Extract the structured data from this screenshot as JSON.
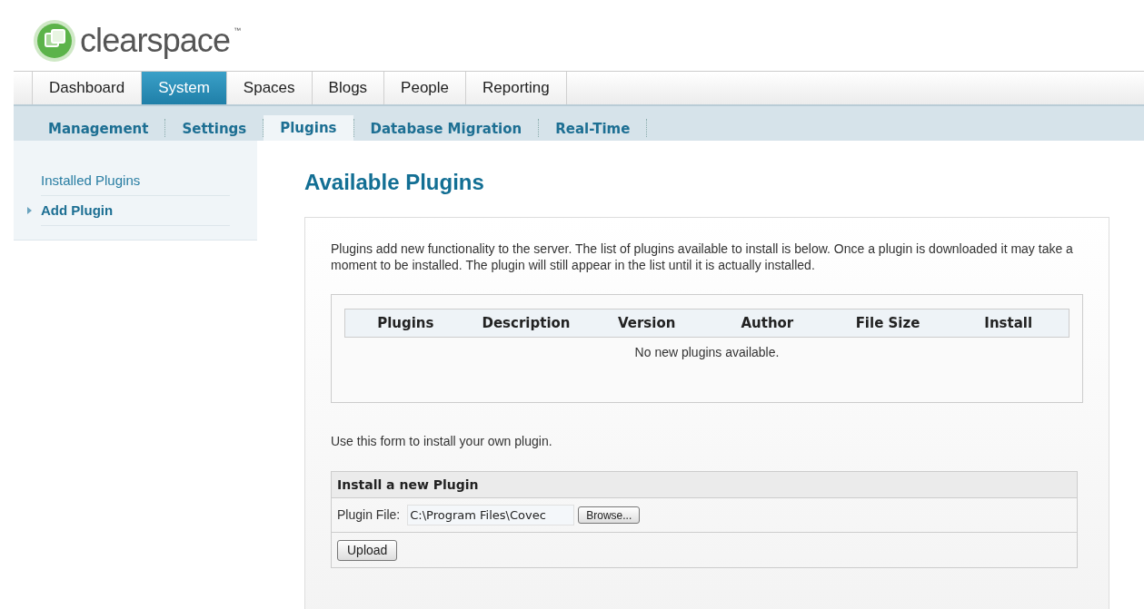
{
  "logo": {
    "name": "clearspace",
    "mark": "™"
  },
  "main_tabs": [
    {
      "label": "Dashboard",
      "selected": false
    },
    {
      "label": "System",
      "selected": true
    },
    {
      "label": "Spaces",
      "selected": false
    },
    {
      "label": "Blogs",
      "selected": false
    },
    {
      "label": "People",
      "selected": false
    },
    {
      "label": "Reporting",
      "selected": false
    }
  ],
  "sub_tabs": [
    {
      "label": "Management",
      "selected": false
    },
    {
      "label": "Settings",
      "selected": false
    },
    {
      "label": "Plugins",
      "selected": true
    },
    {
      "label": "Database Migration",
      "selected": false
    },
    {
      "label": "Real-Time",
      "selected": false
    }
  ],
  "sidebar": {
    "items": [
      {
        "label": "Installed Plugins",
        "selected": false
      },
      {
        "label": "Add Plugin",
        "selected": true
      }
    ]
  },
  "page_title": "Available Plugins",
  "intro": "Plugins add new functionality to the server. The list of plugins available to install is below. Once a plugin is downloaded it may take a moment to be installed. The plugin will still appear in the list until it is actually installed.",
  "table": {
    "columns": [
      "Plugins",
      "Description",
      "Version",
      "Author",
      "File Size",
      "Install"
    ],
    "empty_message": "No new plugins available."
  },
  "form_intro": "Use this form to install your own plugin.",
  "form": {
    "title": "Install a new Plugin",
    "file_label": "Plugin File:",
    "file_value": "C:\\Program Files\\Covec",
    "browse_button": "Browse...",
    "upload_button": "Upload"
  }
}
